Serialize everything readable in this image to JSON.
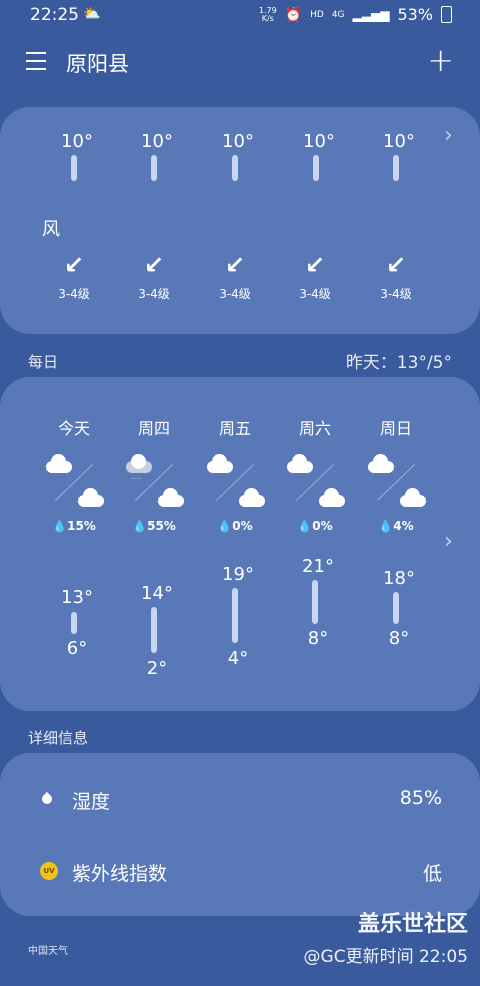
{
  "status_bar": {
    "time": "22:25",
    "net_speed_top": "1.79",
    "net_speed_bottom": "K/s",
    "hd": "HD",
    "network": "4G",
    "battery": "53%"
  },
  "header": {
    "city": "原阳县",
    "add_icon": "+"
  },
  "hourly": {
    "temps": [
      "10°",
      "10°",
      "10°",
      "10°",
      "10°"
    ],
    "wind_label": "风",
    "wind_levels": [
      "3-4级",
      "3-4级",
      "3-4级",
      "3-4级",
      "3-4级"
    ],
    "wind_arrow": "↙"
  },
  "daily": {
    "section_title": "每日",
    "yesterday": "昨天：13°/5°",
    "days": [
      {
        "name": "今天",
        "pop": "15%",
        "high": "13°",
        "low": "6°"
      },
      {
        "name": "周四",
        "pop": "55%",
        "high": "14°",
        "low": "2°"
      },
      {
        "name": "周五",
        "pop": "0%",
        "high": "19°",
        "low": "4°"
      },
      {
        "name": "周六",
        "pop": "0%",
        "high": "21°",
        "low": "8°"
      },
      {
        "name": "周日",
        "pop": "4%",
        "high": "18°",
        "low": "8°"
      }
    ]
  },
  "details": {
    "section_title": "详细信息",
    "humidity_label": "湿度",
    "humidity_value": "85%",
    "uv_label": "紫外线指数",
    "uv_value": "低",
    "uv_icon_text": "UV"
  },
  "footer": {
    "logo_text": "中国天气",
    "updated": "@GC更新时间 22:05",
    "watermark": "盖乐世社区"
  },
  "colors": {
    "background": "#3a5a9e",
    "card": "#5878b7"
  }
}
